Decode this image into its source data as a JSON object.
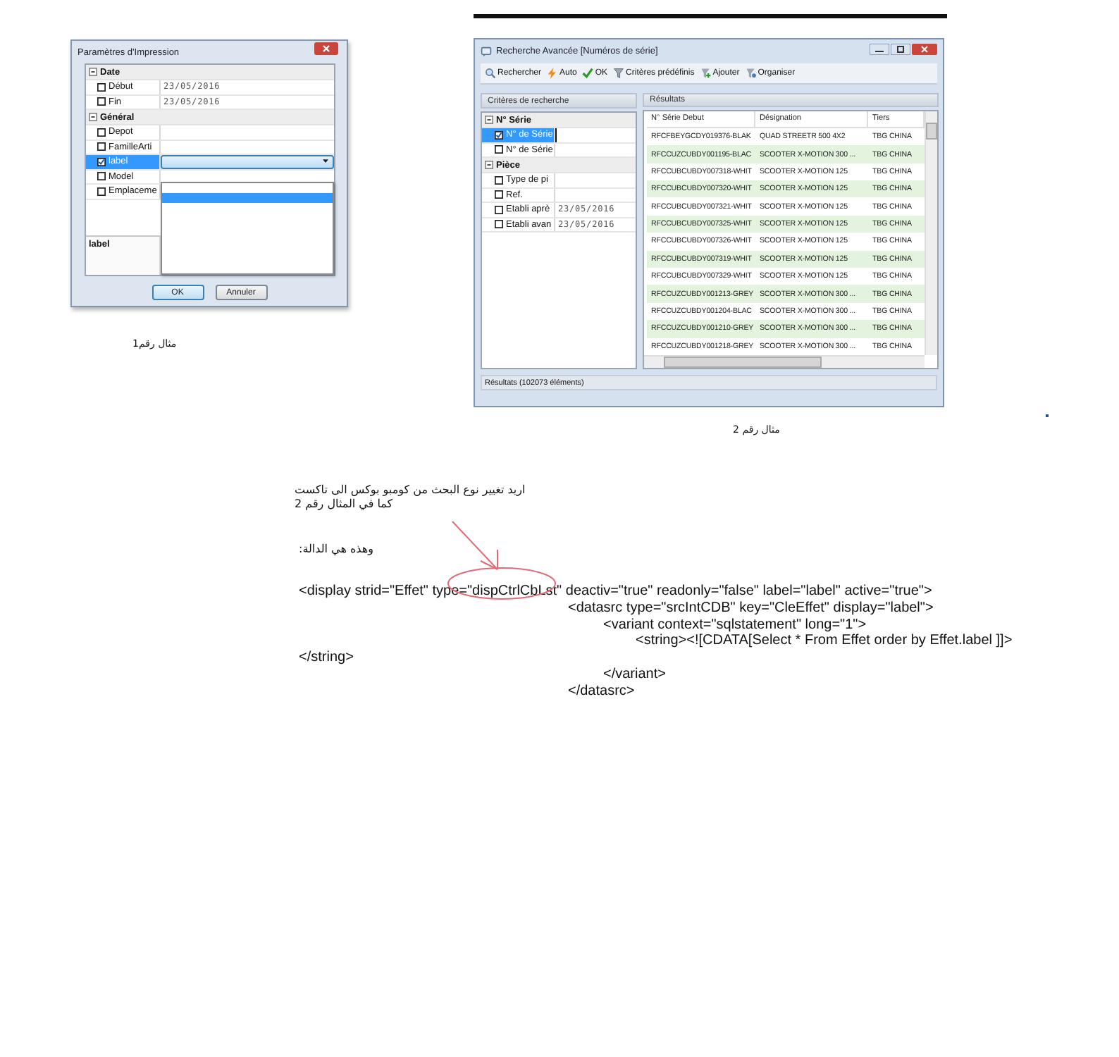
{
  "example_1": {
    "window": {
      "title": "Paramètres d'Impression"
    },
    "groups": [
      {
        "label": "Date",
        "expanded": true,
        "items": [
          {
            "label": "Début",
            "checked": false,
            "selected": false,
            "value": "23/05/2016"
          },
          {
            "label": "Fin",
            "checked": false,
            "selected": false,
            "value": "23/05/2016"
          }
        ]
      },
      {
        "label": "Général",
        "expanded": true,
        "items": [
          {
            "label": "Depot",
            "checked": false,
            "selected": false
          },
          {
            "label": "FamilleArti",
            "checked": false,
            "selected": false
          },
          {
            "label": "label",
            "checked": true,
            "selected": true
          },
          {
            "label": "Model",
            "checked": false,
            "selected": false
          },
          {
            "label": "Emplaceme",
            "checked": false,
            "selected": false
          }
        ]
      }
    ],
    "description": "label",
    "buttons": [
      "OK",
      "Annuler"
    ],
    "caption": "مثال رقم1"
  },
  "example_2": {
    "window": {
      "title": "Recherche Avancée [Numéros de série]"
    },
    "toolbar": [
      {
        "label": "Rechercher",
        "kind": "search"
      },
      {
        "label": "Auto",
        "kind": "auto"
      },
      {
        "label": "OK",
        "kind": "ok"
      },
      {
        "label": "Critères prédéfinis",
        "kind": "filter"
      },
      {
        "label": "Ajouter",
        "kind": "add"
      },
      {
        "label": "Organiser",
        "kind": "organize"
      }
    ],
    "criteria": {
      "title": "Critères de recherche",
      "groups": [
        {
          "label": "N° Série",
          "expanded": true,
          "items": [
            {
              "label": "N° de Série",
              "checked": true,
              "selected": true
            },
            {
              "label": "N° de Série",
              "checked": false,
              "selected": false
            }
          ]
        },
        {
          "label": "Pièce",
          "expanded": true,
          "items": [
            {
              "label": "Type de pi",
              "checked": false,
              "selected": false
            },
            {
              "label": "Ref.",
              "checked": false,
              "selected": false
            },
            {
              "label": "Etabli aprè",
              "checked": false,
              "selected": false,
              "value": "23/05/2016"
            },
            {
              "label": "Etabli avan",
              "checked": false,
              "selected": false,
              "value": "23/05/2016"
            }
          ]
        }
      ]
    },
    "results": {
      "title": "Résultats",
      "columns": [
        "N° Série Debut",
        "Désignation",
        "Tiers"
      ],
      "rows": [
        [
          "RFCFBEYGCDY019376-BLAK",
          "QUAD  STREETR 500 4X2",
          "TBG CHINA"
        ],
        [
          "RFCCUZCUBDY001195-BLAC",
          "SCOOTER X-MOTION 300 ...",
          "TBG CHINA"
        ],
        [
          "RFCCUBCUBDY007318-WHIT",
          "SCOOTER X-MOTION 125",
          "TBG CHINA"
        ],
        [
          "RFCCUBCUBDY007320-WHIT",
          "SCOOTER X-MOTION 125",
          "TBG CHINA"
        ],
        [
          "RFCCUBCUBDY007321-WHIT",
          "SCOOTER X-MOTION 125",
          "TBG CHINA"
        ],
        [
          "RFCCUBCUBDY007325-WHIT",
          "SCOOTER X-MOTION 125",
          "TBG CHINA"
        ],
        [
          "RFCCUBCUBDY007326-WHIT",
          "SCOOTER X-MOTION 125",
          "TBG CHINA"
        ],
        [
          "RFCCUBCUBDY007319-WHIT",
          "SCOOTER X-MOTION 125",
          "TBG CHINA"
        ],
        [
          "RFCCUBCUBDY007329-WHIT",
          "SCOOTER X-MOTION 125",
          "TBG CHINA"
        ],
        [
          "RFCCUZCUBDY001213-GREY",
          "SCOOTER X-MOTION 300 ...",
          "TBG CHINA"
        ],
        [
          "RFCCUZCUBDY001204-BLAC",
          "SCOOTER X-MOTION 300 ...",
          "TBG CHINA"
        ],
        [
          "RFCCUZCUBDY001210-GREY",
          "SCOOTER X-MOTION 300 ...",
          "TBG CHINA"
        ],
        [
          "RFCCUZCUBDY001218-GREY",
          "SCOOTER X-MOTION 300 ...",
          "TBG CHINA"
        ]
      ]
    },
    "status_bar": "Résultats (102073 éléments)",
    "caption": "مثال رقم 2"
  },
  "notes": {
    "intro": [
      "اريد تغيير نوع البحث من كومبو بوكس الى تاكست",
      "كما في المثال رقم 2"
    ],
    "function_label": "وهذه هي الدالة:",
    "code_lines": [
      {
        "kind": "outer",
        "text": "<display strid=\"Effet\" type=\"dispCtrlCbLst\" deactiv=\"true\" readonly=\"false\" label=\"label\" active=\"true\">"
      },
      {
        "kind": "datasrc",
        "text": "<datasrc type=\"srcIntCDB\" key=\"CleEffet\" display=\"label\">"
      },
      {
        "kind": "variant",
        "text": "<variant context=\"sqlstatement\" long=\"1\">"
      },
      {
        "kind": "string",
        "text": "<string><![CDATA[Select * From Effet order by Effet.label ]]>"
      },
      {
        "kind": "outer",
        "text": "</string>"
      },
      {
        "kind": "variant",
        "text": "</variant>"
      },
      {
        "kind": "datasrc",
        "text": "</datasrc>"
      }
    ]
  }
}
